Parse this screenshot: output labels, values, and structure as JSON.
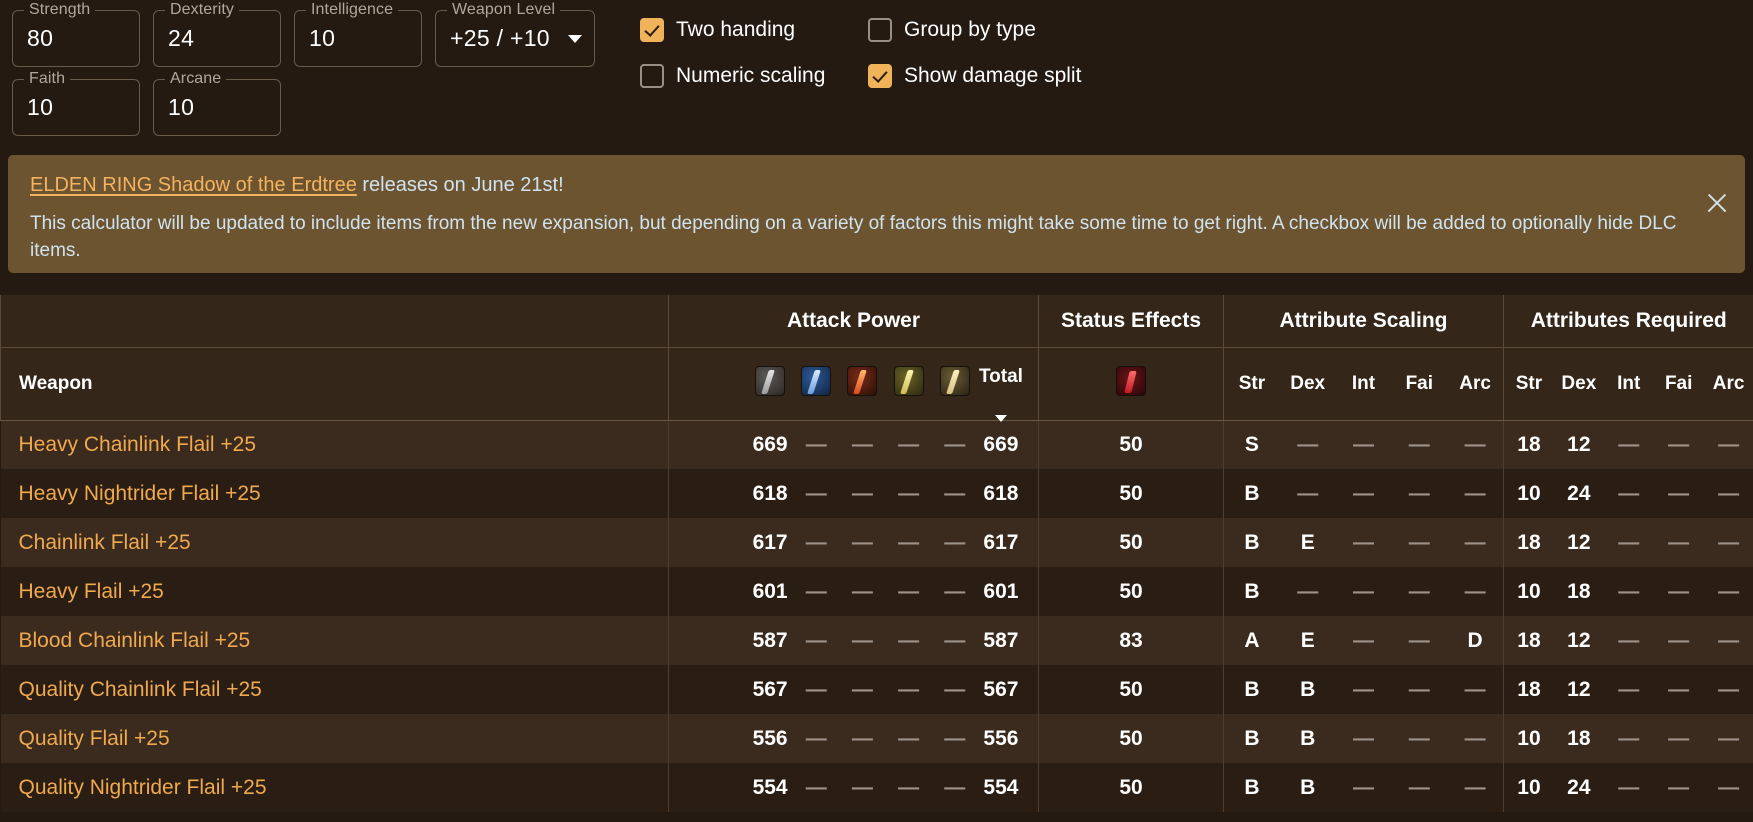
{
  "attributes": [
    {
      "label": "Strength",
      "value": "80",
      "name": "strength"
    },
    {
      "label": "Dexterity",
      "value": "24",
      "name": "dexterity"
    },
    {
      "label": "Intelligence",
      "value": "10",
      "name": "intelligence"
    },
    {
      "label": "Weapon Level",
      "value": "+25 / +10",
      "name": "weapon-level"
    },
    {
      "label": "Faith",
      "value": "10",
      "name": "faith"
    },
    {
      "label": "Arcane",
      "value": "10",
      "name": "arcane"
    }
  ],
  "checkboxes": [
    {
      "label": "Two handing",
      "checked": true
    },
    {
      "label": "Group by type",
      "checked": false
    },
    {
      "label": "Numeric scaling",
      "checked": false
    },
    {
      "label": "Show damage split",
      "checked": true
    }
  ],
  "banner": {
    "link_text": "ELDEN RING Shadow of the Erdtree",
    "title_rest": " releases on June 21st!",
    "body": "This calculator will be updated to include items from the new expansion, but depending on a variety of factors this might take some time to get right. A checkbox will be added to optionally hide DLC items.",
    "close_label": "×"
  },
  "table": {
    "groups": {
      "weapon": "",
      "attack_power": "Attack Power",
      "status_effects": "Status Effects",
      "attribute_scaling": "Attribute Scaling",
      "attributes_required": "Attributes Required"
    },
    "sub_headers": {
      "weapon": "Weapon",
      "total": "Total",
      "damage_icons": [
        "physical-damage-icon",
        "magic-damage-icon",
        "fire-damage-icon",
        "lightning-damage-icon",
        "holy-damage-icon"
      ],
      "status_icon": "bleed-status-icon",
      "scaling": [
        "Str",
        "Dex",
        "Int",
        "Fai",
        "Arc"
      ],
      "required": [
        "Str",
        "Dex",
        "Int",
        "Fai",
        "Arc"
      ]
    },
    "sort_column": "Total",
    "rows": [
      {
        "weapon": "Heavy Chainlink Flail +25",
        "damage": [
          "669",
          "—",
          "—",
          "—",
          "—"
        ],
        "total": "669",
        "status": "50",
        "scaling": [
          "S",
          "—",
          "—",
          "—",
          "—"
        ],
        "required": [
          "18",
          "12",
          "—",
          "—",
          "—"
        ]
      },
      {
        "weapon": "Heavy Nightrider Flail +25",
        "damage": [
          "618",
          "—",
          "—",
          "—",
          "—"
        ],
        "total": "618",
        "status": "50",
        "scaling": [
          "B",
          "—",
          "—",
          "—",
          "—"
        ],
        "required": [
          "10",
          "24",
          "—",
          "—",
          "—"
        ]
      },
      {
        "weapon": "Chainlink Flail +25",
        "damage": [
          "617",
          "—",
          "—",
          "—",
          "—"
        ],
        "total": "617",
        "status": "50",
        "scaling": [
          "B",
          "E",
          "—",
          "—",
          "—"
        ],
        "required": [
          "18",
          "12",
          "—",
          "—",
          "—"
        ]
      },
      {
        "weapon": "Heavy Flail +25",
        "damage": [
          "601",
          "—",
          "—",
          "—",
          "—"
        ],
        "total": "601",
        "status": "50",
        "scaling": [
          "B",
          "—",
          "—",
          "—",
          "—"
        ],
        "required": [
          "10",
          "18",
          "—",
          "—",
          "—"
        ]
      },
      {
        "weapon": "Blood Chainlink Flail +25",
        "damage": [
          "587",
          "—",
          "—",
          "—",
          "—"
        ],
        "total": "587",
        "status": "83",
        "scaling": [
          "A",
          "E",
          "—",
          "—",
          "D"
        ],
        "required": [
          "18",
          "12",
          "—",
          "—",
          "—"
        ]
      },
      {
        "weapon": "Quality Chainlink Flail +25",
        "damage": [
          "567",
          "—",
          "—",
          "—",
          "—"
        ],
        "total": "567",
        "status": "50",
        "scaling": [
          "B",
          "B",
          "—",
          "—",
          "—"
        ],
        "required": [
          "18",
          "12",
          "—",
          "—",
          "—"
        ]
      },
      {
        "weapon": "Quality Flail +25",
        "damage": [
          "556",
          "—",
          "—",
          "—",
          "—"
        ],
        "total": "556",
        "status": "50",
        "scaling": [
          "B",
          "B",
          "—",
          "—",
          "—"
        ],
        "required": [
          "10",
          "18",
          "—",
          "—",
          "—"
        ]
      },
      {
        "weapon": "Quality Nightrider Flail +25",
        "damage": [
          "554",
          "—",
          "—",
          "—",
          "—"
        ],
        "total": "554",
        "status": "50",
        "scaling": [
          "B",
          "B",
          "—",
          "—",
          "—"
        ],
        "required": [
          "10",
          "24",
          "—",
          "—",
          "—"
        ]
      }
    ]
  },
  "colors": {
    "background": "#241a12",
    "banner_bg": "#6d5430",
    "accent_orange": "#f0a94e",
    "link_blue": "#cfe3ef",
    "checkbox_on": "#f1b35a",
    "row_odd": "#3a2b1e",
    "row_even": "#2a1d13"
  }
}
